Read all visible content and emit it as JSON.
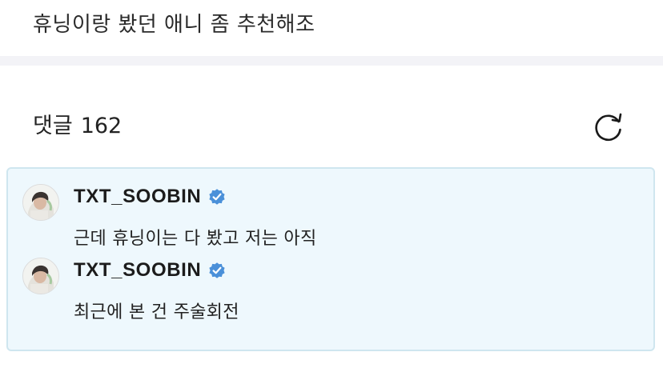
{
  "post": {
    "title": "휴닝이랑 봤던 애니 좀 추천해조"
  },
  "comments_section": {
    "label": "댓글",
    "count": "162",
    "refresh_icon": "refresh-icon"
  },
  "comments": [
    {
      "author": "TXT_SOOBIN",
      "verified": true,
      "text": "근데 휴닝이는 다 봤고 저는 아직"
    },
    {
      "author": "TXT_SOOBIN",
      "verified": true,
      "text": "최근에 본 건 주술회전"
    }
  ],
  "colors": {
    "chat_background": "#eef8fd",
    "chat_border": "#cfe6ef",
    "verified_badge": "#4a90d9",
    "divider_band": "#f3f3f7"
  }
}
